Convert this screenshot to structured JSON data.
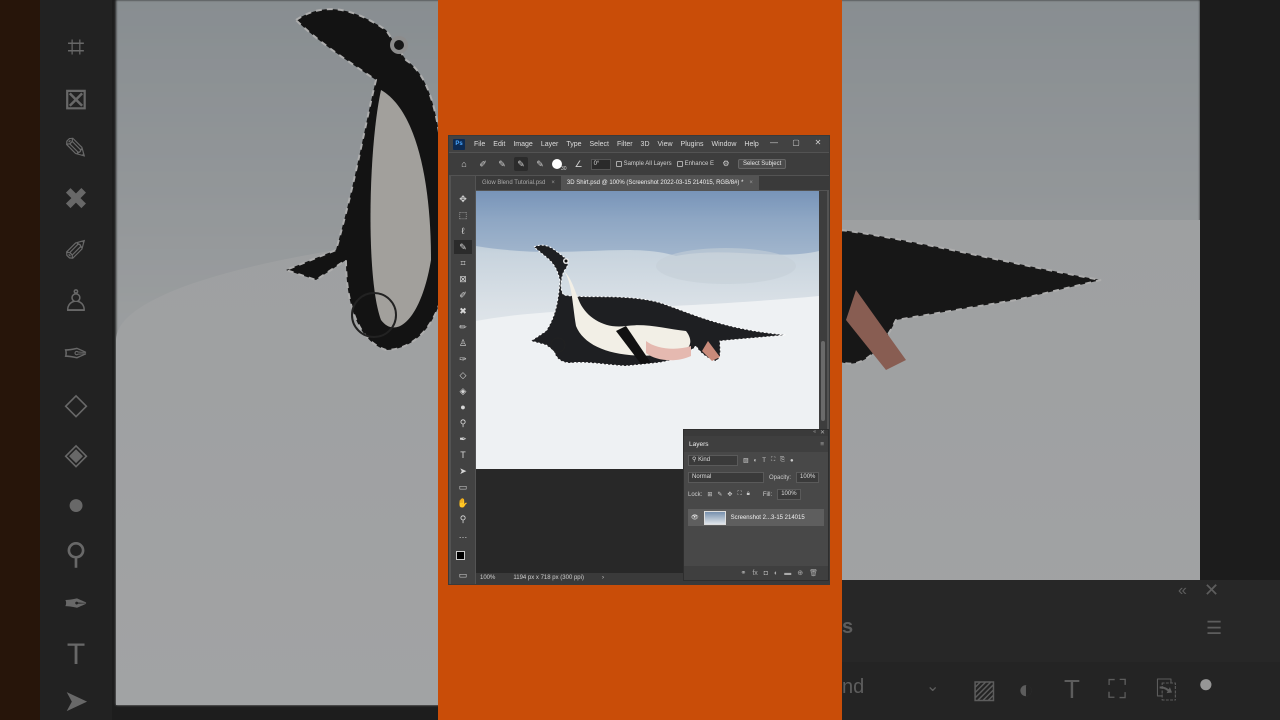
{
  "colors": {
    "accent_orange": "#c94d08",
    "ps_background": "#535353",
    "panel_dark": "#3d3d3d"
  },
  "menu": {
    "logo": "Ps",
    "items": [
      "File",
      "Edit",
      "Image",
      "Layer",
      "Type",
      "Select",
      "Filter",
      "3D",
      "View",
      "Plugins",
      "Window",
      "Help"
    ]
  },
  "options": {
    "brush_size": "30",
    "angle": "0°",
    "sample_all_layers": "Sample All Layers",
    "enhance_edge": "Enhance E",
    "select_subject": "Select Subject"
  },
  "tabs": [
    {
      "label": "Glow Blend Tutorial.psd",
      "active": false
    },
    {
      "label": "3D Shirt.psd @ 100% (Screenshot 2022-03-15 214015, RGB/8#) *",
      "active": true
    }
  ],
  "status": {
    "zoom": "100%",
    "doc_info": "1194 px x 718 px (300 ppi)"
  },
  "layers": {
    "title": "Layers",
    "filter_kind": "Kind",
    "blend_mode": "Normal",
    "opacity_label": "Opacity:",
    "opacity_value": "100%",
    "lock_label": "Lock:",
    "fill_label": "Fill:",
    "fill_value": "100%",
    "layer_name": "Screenshot 2...3-15 214015"
  },
  "background_panel": {
    "label_fragment": "nd",
    "tab_fragment": "s"
  }
}
